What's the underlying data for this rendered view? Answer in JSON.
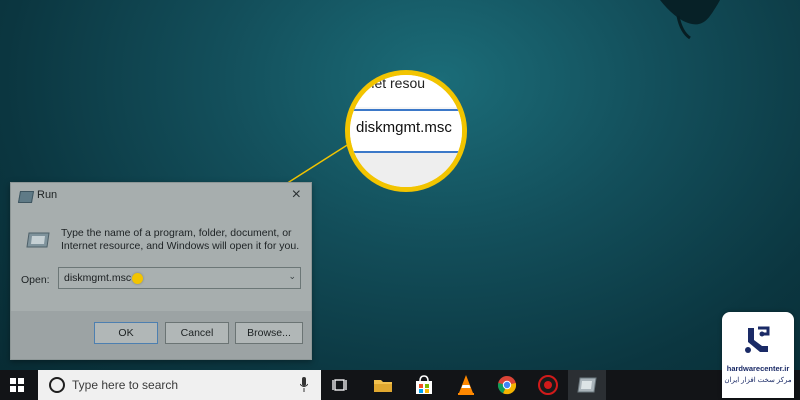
{
  "run_dialog": {
    "title": "Run",
    "close_glyph": "×",
    "desc_lines": [
      "Type the name of a program, folder, document, or",
      "Internet resource, and Windows will open it for you."
    ],
    "open_label": "Open:",
    "open_value": "diskmgmt.msc",
    "dropdown_glyph": "⌄",
    "buttons": {
      "ok": "OK",
      "cancel": "Cancel",
      "browse": "Browse..."
    }
  },
  "zoom": {
    "top_text": "rnet resou",
    "field_text": "diskmgmt.msc"
  },
  "taskbar": {
    "search_placeholder": "Type here to search",
    "icons": [
      "windows-start-icon",
      "microphone-icon",
      "task-view-icon",
      "file-explorer-icon",
      "store-icon",
      "vlc-icon",
      "chrome-icon",
      "security-app-icon",
      "run-app-icon"
    ]
  },
  "watermark": {
    "site": "hardwarecenter.ir",
    "fa_text": "مرکز سخت افزار ایران"
  },
  "colors": {
    "highlight": "#f2c400",
    "input_border": "#3b78c8",
    "taskbar": "#121417"
  }
}
